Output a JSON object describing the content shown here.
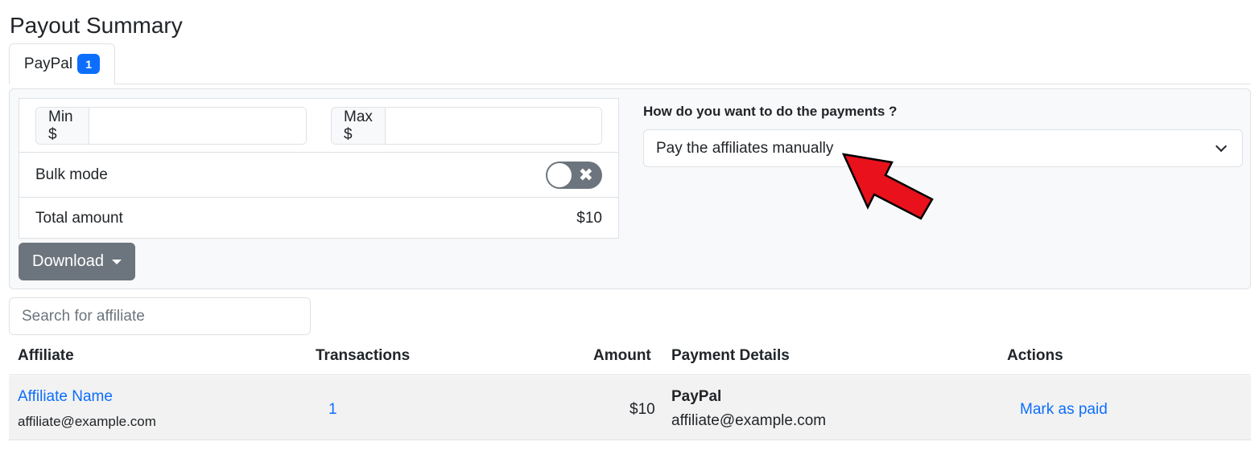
{
  "page": {
    "title": "Payout Summary"
  },
  "tabs": [
    {
      "label": "PayPal",
      "badge": "1"
    }
  ],
  "filters": {
    "min_label": "Min $",
    "max_label": "Max $",
    "min_value": "",
    "max_value": ""
  },
  "bulk": {
    "label": "Bulk mode",
    "enabled": false
  },
  "total": {
    "label": "Total amount",
    "value": "$10"
  },
  "download": {
    "label": "Download"
  },
  "payments": {
    "question": "How do you want to do the payments ?",
    "selected": "Pay the affiliates manually"
  },
  "search": {
    "placeholder": "Search for affiliate"
  },
  "table": {
    "headers": {
      "affiliate": "Affiliate",
      "transactions": "Transactions",
      "amount": "Amount",
      "payment_details": "Payment Details",
      "actions": "Actions"
    },
    "rows": [
      {
        "affiliate_name": "Affiliate Name",
        "affiliate_email": "affiliate@example.com",
        "transactions": "1",
        "amount": "$10",
        "method": "PayPal",
        "payment_email": "affiliate@example.com",
        "action": "Mark as paid"
      }
    ]
  },
  "colors": {
    "accent": "#0d6efd",
    "secondary": "#6c757d",
    "annotation_arrow": "#e8111c"
  },
  "icons": {
    "toggle": "x-icon",
    "dropdown": "chevron-down-icon",
    "download_caret": "caret-down-icon"
  }
}
